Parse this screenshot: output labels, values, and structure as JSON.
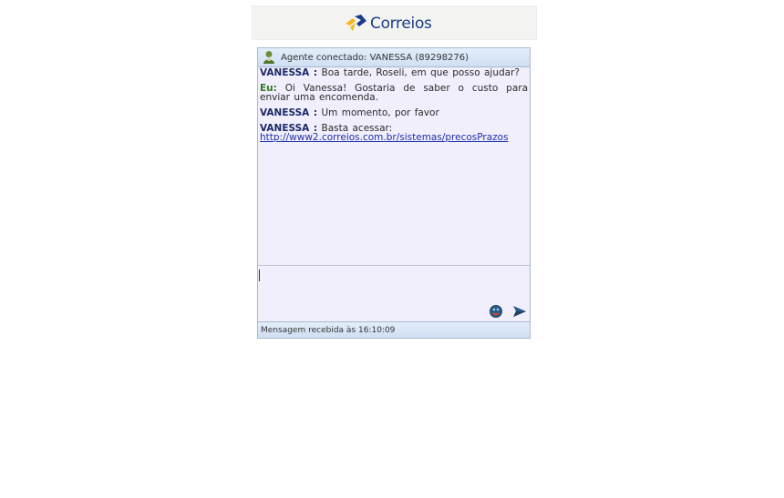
{
  "header": {
    "logo_text": "Correios",
    "logo_colors": {
      "yellow": "#f5b81c",
      "blue": "#1b3c87"
    }
  },
  "chat": {
    "agent_status": "Agente conectado: VANESSA (89298276)",
    "messages": [
      {
        "author": "VANESSA :",
        "text": "Boa tarde, Roseli, em que posso ajudar?"
      },
      {
        "author": "Eu:",
        "text": "Oi Vanessa! Gostaria de saber o custo para enviar uma encomenda."
      },
      {
        "author": "VANESSA :",
        "text": "Um momento, por favor"
      },
      {
        "author": "VANESSA :",
        "text": "Basta acessar:",
        "link": "http://www2.correios.com.br/sistemas/precosPrazos"
      }
    ],
    "input_value": "",
    "status": "Mensagem recebida às 16:10:09",
    "icons": {
      "agent": "agent-user-icon",
      "emoticon": "emoticon-icon",
      "send": "send-icon"
    }
  }
}
